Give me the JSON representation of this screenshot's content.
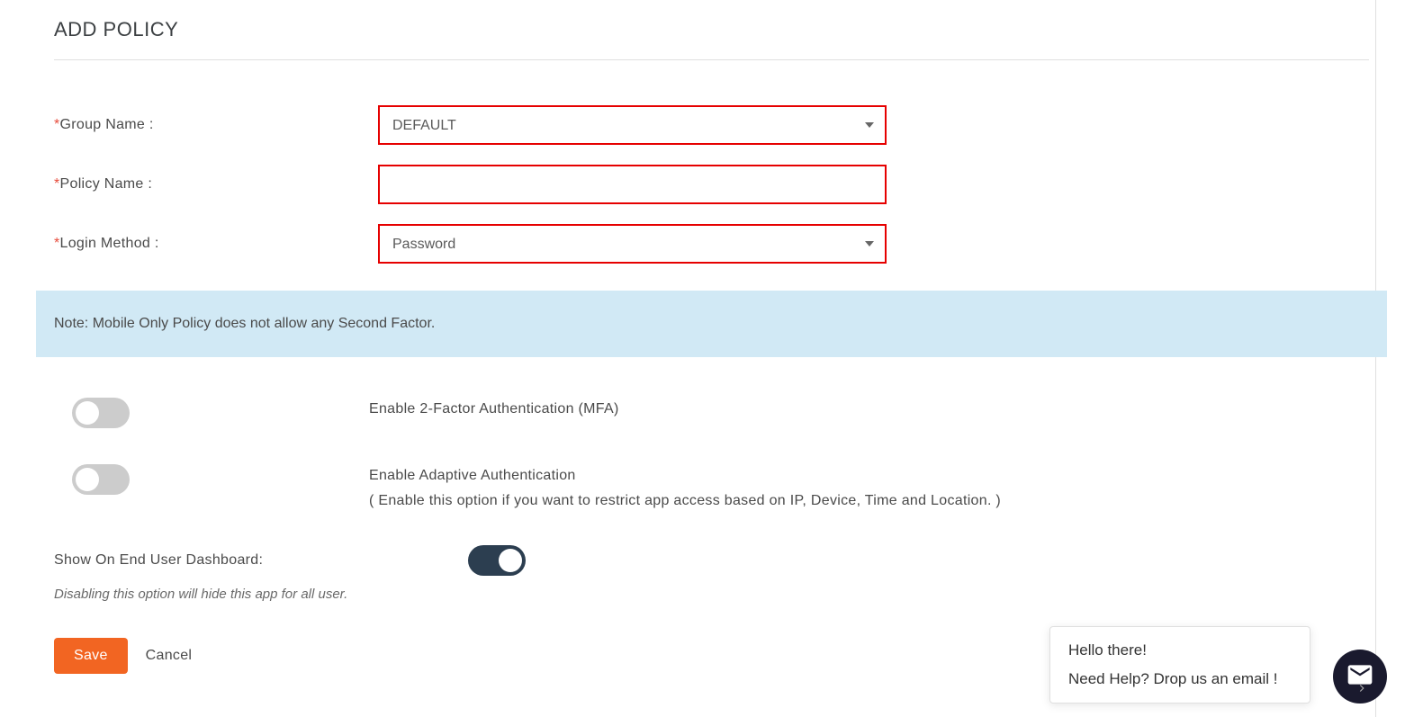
{
  "page": {
    "title": "ADD POLICY"
  },
  "form": {
    "group_name": {
      "label": "Group Name :",
      "value": "DEFAULT"
    },
    "policy_name": {
      "label": "Policy Name :",
      "value": ""
    },
    "login_method": {
      "label": "Login Method :",
      "value": "Password"
    }
  },
  "note": {
    "text": "Note: Mobile Only Policy does not allow any Second Factor."
  },
  "toggles": {
    "mfa": {
      "label": "Enable 2-Factor Authentication (MFA)",
      "enabled": false
    },
    "adaptive": {
      "label": "Enable Adaptive Authentication",
      "hint": "( Enable this option if you want to restrict app access based on IP, Device, Time and Location. )",
      "enabled": false
    },
    "dashboard": {
      "label": "Show On End User Dashboard:",
      "hint": "Disabling this option will hide this app for all user.",
      "enabled": true
    }
  },
  "buttons": {
    "save": "Save",
    "cancel": "Cancel"
  },
  "chat": {
    "greeting": "Hello there!",
    "help": "Need Help? Drop us an email !"
  }
}
